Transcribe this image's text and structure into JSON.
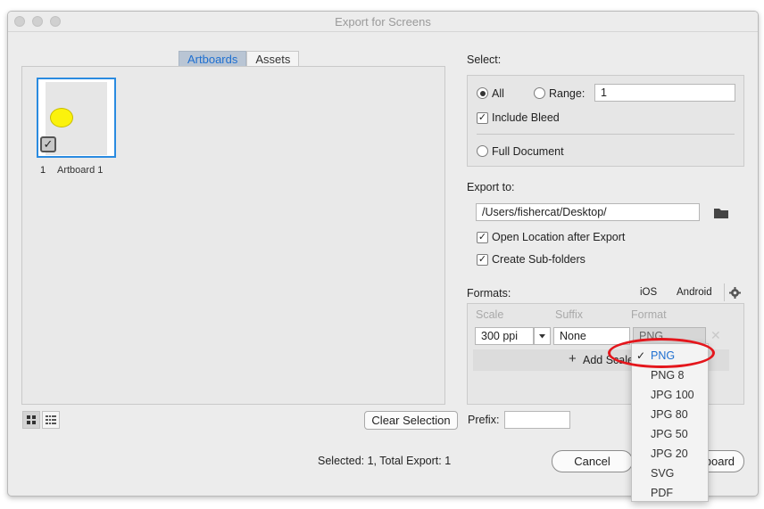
{
  "window": {
    "title": "Export for Screens"
  },
  "tabs": [
    {
      "label": "Artboards"
    },
    {
      "label": "Assets"
    }
  ],
  "artboards": [
    {
      "number": "1",
      "name": "Artboard 1",
      "checked": true
    }
  ],
  "select": {
    "heading": "Select:",
    "all_label": "All",
    "range_label": "Range:",
    "range_value": "1",
    "include_bleed_label": "Include Bleed",
    "full_document_label": "Full Document"
  },
  "export_to": {
    "heading": "Export to:",
    "path": "/Users/fishercat/Desktop/",
    "open_location_label": "Open Location after Export",
    "create_subfolders_label": "Create Sub-folders"
  },
  "formats": {
    "heading": "Formats:",
    "ios_label": "iOS",
    "android_label": "Android",
    "col_scale": "Scale",
    "col_suffix": "Suffix",
    "col_format": "Format",
    "scale_value": "300 ppi",
    "suffix_value": "None",
    "format_value": "PNG",
    "add_scale_label": "Add Scale"
  },
  "dropdown": {
    "items": [
      "PNG",
      "PNG 8",
      "JPG 100",
      "JPG 80",
      "JPG 50",
      "JPG 20",
      "SVG",
      "PDF"
    ],
    "selected_index": 0
  },
  "footer": {
    "clear_selection_label": "Clear Selection",
    "prefix_label": "Prefix:",
    "prefix_value": "",
    "status": "Selected: 1, Total Export: 1",
    "cancel_label": "Cancel",
    "export_label_visible": "board"
  },
  "colors": {
    "accent": "#1e6fd0",
    "highlight_ring": "#e4161c",
    "artboard_shape": "#fbf20c"
  }
}
